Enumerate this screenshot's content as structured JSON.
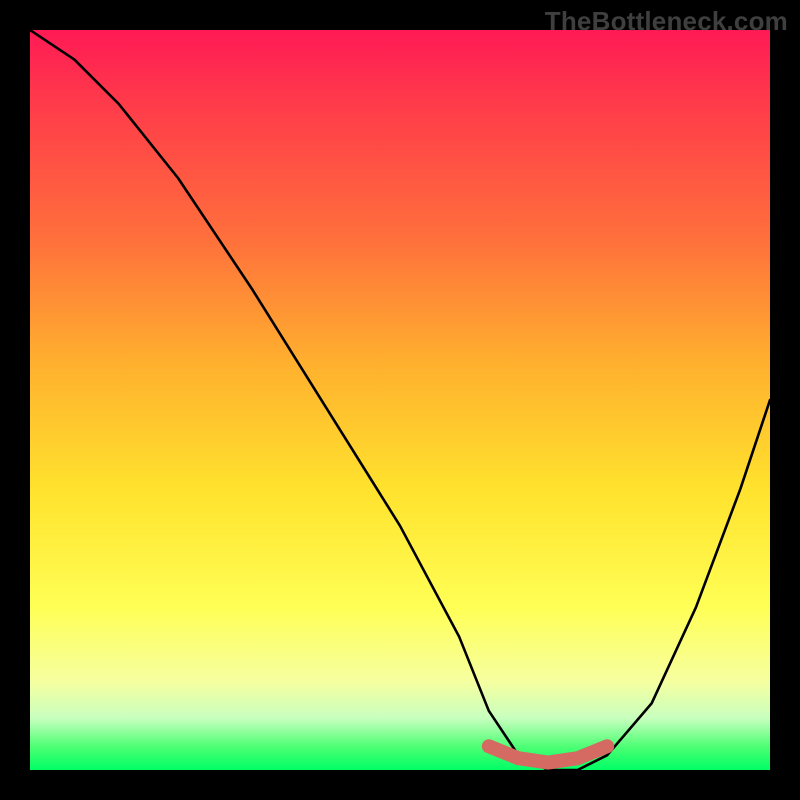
{
  "watermark": "TheBottleneck.com",
  "chart_data": {
    "type": "line",
    "title": "",
    "xlabel": "",
    "ylabel": "",
    "xlim": [
      0,
      100
    ],
    "ylim": [
      0,
      100
    ],
    "series": [
      {
        "name": "bottleneck-curve",
        "x": [
          0,
          6,
          12,
          20,
          30,
          40,
          50,
          58,
          62,
          66,
          70,
          74,
          78,
          84,
          90,
          96,
          100
        ],
        "y": [
          100,
          96,
          90,
          80,
          65,
          49,
          33,
          18,
          8,
          2,
          0,
          0,
          2,
          9,
          22,
          38,
          50
        ]
      }
    ],
    "highlight": {
      "name": "flat-valley",
      "x": [
        62,
        66,
        70,
        74,
        78
      ],
      "y": [
        3.2,
        1.6,
        1.0,
        1.6,
        3.2
      ],
      "color": "#d46a62"
    },
    "gradient_stops": [
      {
        "pos": 0.0,
        "color": "#ff1a55"
      },
      {
        "pos": 0.1,
        "color": "#ff3b4a"
      },
      {
        "pos": 0.28,
        "color": "#ff6f3c"
      },
      {
        "pos": 0.45,
        "color": "#ffb02e"
      },
      {
        "pos": 0.62,
        "color": "#ffe22d"
      },
      {
        "pos": 0.78,
        "color": "#ffff55"
      },
      {
        "pos": 0.88,
        "color": "#f6ffa0"
      },
      {
        "pos": 0.93,
        "color": "#c8ffbe"
      },
      {
        "pos": 0.97,
        "color": "#49ff72"
      },
      {
        "pos": 1.0,
        "color": "#00ff66"
      }
    ]
  }
}
